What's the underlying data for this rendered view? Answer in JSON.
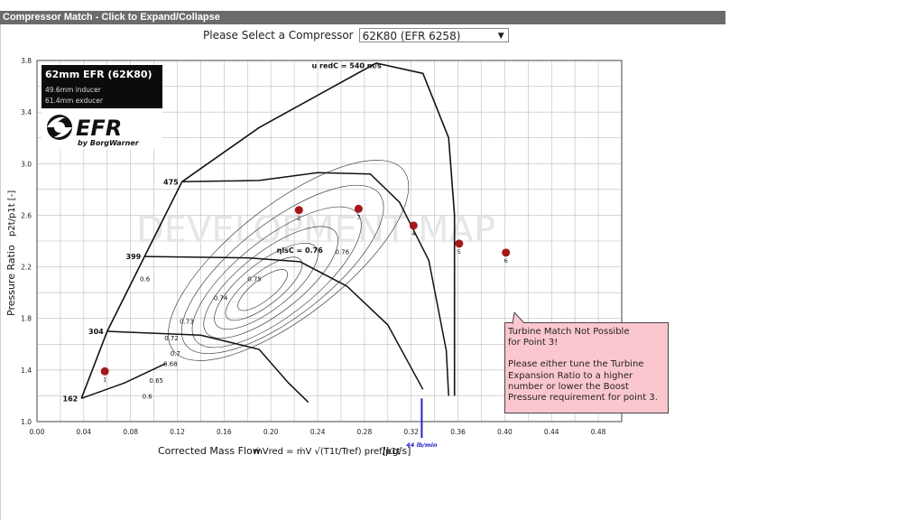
{
  "panel": {
    "title": "Compressor Match - Click to Expand/Collapse"
  },
  "selector": {
    "label": "Please Select a Compressor",
    "value": "62K80 (EFR 6258)",
    "arrow_icon": "dropdown-arrow-icon"
  },
  "chart_data": {
    "type": "scatter",
    "xlabel": "Corrected Mass Flow",
    "xlabel_formula": "ṁVred = ṁV √(T1t/Tref) pref/p1t",
    "xlabel_unit": "[kg/s]",
    "ylabel_text": "Pressure Ratio",
    "ylabel_formula": "p2t/p1t [-]",
    "x_ticks": [
      "0.00",
      "0.04",
      "0.08",
      "0.12",
      "0.16",
      "0.20",
      "0.24",
      "0.28",
      "0.32",
      "0.36",
      "0.40",
      "0.44",
      "0.48"
    ],
    "y_ticks": [
      "1.0",
      "1.4",
      "1.8",
      "2.2",
      "2.6",
      "3.0",
      "3.4",
      "3.8"
    ],
    "xlim": [
      0.0,
      0.5
    ],
    "ylim": [
      1.0,
      3.8
    ],
    "grid": true,
    "watermark": "DEVELOPMENT MAP",
    "brand": {
      "title": "62mm EFR  (62K80)",
      "inducer": "49.6mm inducer",
      "exducer": "61.4mm exducer",
      "logo": "EFR",
      "logo_sub": "by BorgWarner"
    },
    "speed_lines": [
      {
        "label": "162",
        "points": [
          [
            0.038,
            1.18
          ],
          [
            0.075,
            1.3
          ],
          [
            0.11,
            1.45
          ]
        ]
      },
      {
        "label": "304",
        "points": [
          [
            0.06,
            1.7
          ],
          [
            0.14,
            1.67
          ],
          [
            0.19,
            1.56
          ],
          [
            0.215,
            1.3
          ],
          [
            0.232,
            1.15
          ]
        ]
      },
      {
        "label": "399",
        "points": [
          [
            0.092,
            2.28
          ],
          [
            0.18,
            2.27
          ],
          [
            0.225,
            2.24
          ],
          [
            0.265,
            2.05
          ],
          [
            0.3,
            1.75
          ],
          [
            0.33,
            1.25
          ]
        ]
      },
      {
        "label": "475",
        "points": [
          [
            0.124,
            2.86
          ],
          [
            0.19,
            2.87
          ],
          [
            0.24,
            2.93
          ],
          [
            0.285,
            2.92
          ],
          [
            0.31,
            2.7
          ],
          [
            0.335,
            2.25
          ],
          [
            0.35,
            1.55
          ],
          [
            0.352,
            1.2
          ]
        ]
      }
    ],
    "surge_line": [
      [
        0.038,
        1.18
      ],
      [
        0.06,
        1.7
      ],
      [
        0.092,
        2.28
      ],
      [
        0.124,
        2.86
      ],
      [
        0.19,
        3.28
      ],
      [
        0.25,
        3.58
      ],
      [
        0.29,
        3.78
      ]
    ],
    "choke_line": [
      [
        0.29,
        3.78
      ],
      [
        0.33,
        3.7
      ],
      [
        0.352,
        3.2
      ],
      [
        0.357,
        2.6
      ],
      [
        0.357,
        1.2
      ]
    ],
    "efficiency_labels": [
      {
        "label": "0.6",
        "x": 0.09,
        "y": 1.18
      },
      {
        "label": "0.65",
        "x": 0.096,
        "y": 1.3
      },
      {
        "label": "0.68",
        "x": 0.108,
        "y": 1.43
      },
      {
        "label": "0.7",
        "x": 0.114,
        "y": 1.51
      },
      {
        "label": "0.72",
        "x": 0.109,
        "y": 1.63
      },
      {
        "label": "0.73",
        "x": 0.122,
        "y": 1.76
      },
      {
        "label": "0.74",
        "x": 0.151,
        "y": 1.94
      },
      {
        "label": "0.75",
        "x": 0.18,
        "y": 2.09
      },
      {
        "label": "0.76",
        "x": 0.255,
        "y": 2.3
      },
      {
        "label": "0.6",
        "x": 0.088,
        "y": 2.09
      }
    ],
    "annotations": [
      {
        "text": "u redC = 540 m/s",
        "x": 0.235,
        "y": 3.74
      },
      {
        "text": "ηisC = 0.76",
        "x": 0.205,
        "y": 2.31
      }
    ],
    "points": [
      {
        "label": "1",
        "x": 0.058,
        "y": 1.39
      },
      {
        "label": "2",
        "x": 0.224,
        "y": 2.64
      },
      {
        "label": "3",
        "x": 0.275,
        "y": 2.65
      },
      {
        "label": "4",
        "x": 0.322,
        "y": 2.52
      },
      {
        "label": "5",
        "x": 0.361,
        "y": 2.38
      },
      {
        "label": "6",
        "x": 0.401,
        "y": 2.31
      }
    ],
    "marker": {
      "label": "44 lb/min",
      "x": 0.329
    },
    "colors": {
      "point": "#a3191b",
      "marker": "#2222cc",
      "line": "#111111",
      "grid": "#bdbdbd",
      "tooltip_bg": "#fbc7cf"
    }
  },
  "tooltip": {
    "line1": "Turbine Match Not Possible",
    "line2": "for Point 3!",
    "body": "Please either tune the Turbine Expansion Ratio to a higher number or lower the Boost Pressure requirement for point 3."
  }
}
